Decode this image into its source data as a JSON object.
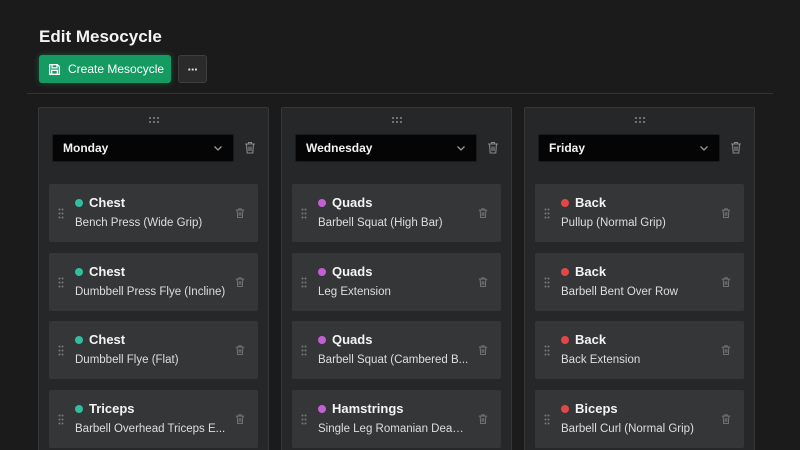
{
  "header": {
    "title": "Edit Mesocycle",
    "create_label": "Create Mesocycle",
    "more_label": "···"
  },
  "colors": {
    "accent": "#159a62",
    "chest": "#2fbf9f",
    "triceps": "#2fbf9f",
    "quads": "#c35fd4",
    "hamstrings": "#c35fd4",
    "back": "#e04848",
    "biceps": "#e04848"
  },
  "days": [
    {
      "day": "Monday",
      "exercises": [
        {
          "muscle": "Chest",
          "name": "Bench Press (Wide Grip)",
          "color": "#2fbf9f"
        },
        {
          "muscle": "Chest",
          "name": "Dumbbell Press Flye (Incline)",
          "color": "#2fbf9f"
        },
        {
          "muscle": "Chest",
          "name": "Dumbbell Flye (Flat)",
          "color": "#2fbf9f"
        },
        {
          "muscle": "Triceps",
          "name": "Barbell Overhead Triceps E...",
          "color": "#2fbf9f"
        }
      ]
    },
    {
      "day": "Wednesday",
      "exercises": [
        {
          "muscle": "Quads",
          "name": "Barbell Squat (High Bar)",
          "color": "#c35fd4"
        },
        {
          "muscle": "Quads",
          "name": "Leg Extension",
          "color": "#c35fd4"
        },
        {
          "muscle": "Quads",
          "name": "Barbell Squat (Cambered B...",
          "color": "#c35fd4"
        },
        {
          "muscle": "Hamstrings",
          "name": "Single Leg Romanian Deadlift",
          "color": "#c35fd4"
        }
      ]
    },
    {
      "day": "Friday",
      "exercises": [
        {
          "muscle": "Back",
          "name": "Pullup (Normal Grip)",
          "color": "#e04848"
        },
        {
          "muscle": "Back",
          "name": "Barbell Bent Over Row",
          "color": "#e04848"
        },
        {
          "muscle": "Back",
          "name": "Back Extension",
          "color": "#e04848"
        },
        {
          "muscle": "Biceps",
          "name": "Barbell Curl (Normal Grip)",
          "color": "#e04848"
        }
      ]
    }
  ]
}
